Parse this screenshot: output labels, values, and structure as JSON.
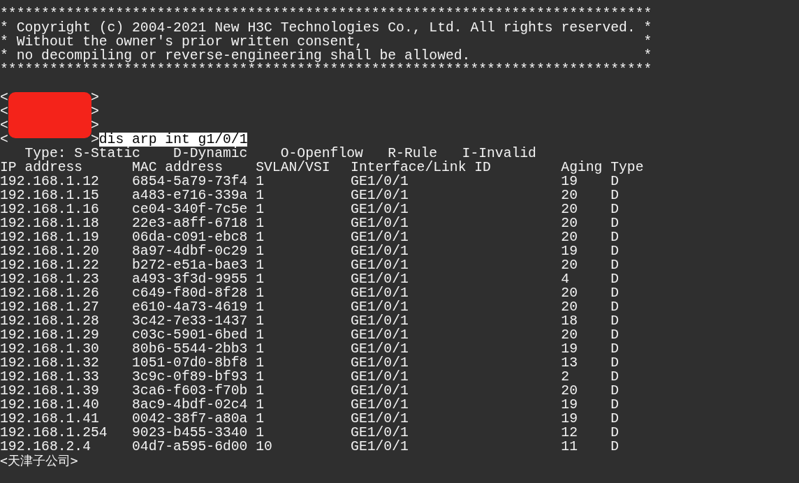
{
  "terminal": {
    "banner": [
      {
        "kind": "rule",
        "text": "*******************************************************************************"
      },
      {
        "kind": "line",
        "text": "* Copyright (c) 2004-2021 New H3C Technologies Co., Ltd. All rights reserved.",
        "end": "*"
      },
      {
        "kind": "line",
        "text": "* Without the owner's prior written consent,",
        "end": "*"
      },
      {
        "kind": "line",
        "text": "* no decompiling or reverse-engineering shall be allowed.",
        "end": "*"
      },
      {
        "kind": "rule",
        "text": "*******************************************************************************"
      }
    ],
    "prompts_redacted": true,
    "prompts": [
      {
        "open": "<",
        "close": ">"
      },
      {
        "open": "<",
        "close": ">"
      },
      {
        "open": "<",
        "close": ">"
      },
      {
        "open": "<",
        "close": ">",
        "command": "dis arp int g1/0/1",
        "selected": true
      }
    ],
    "legend": "   Type: S-Static    D-Dynamic    O-Openflow   R-Rule   I-Invalid",
    "table": {
      "columns": [
        "IP address",
        "MAC address",
        "SVLAN/VSI",
        "Interface/Link ID",
        "Aging",
        "Type"
      ],
      "rows": [
        [
          "192.168.1.12",
          "6854-5a79-73f4",
          "1",
          "GE1/0/1",
          "19",
          "D"
        ],
        [
          "192.168.1.15",
          "a483-e716-339a",
          "1",
          "GE1/0/1",
          "20",
          "D"
        ],
        [
          "192.168.1.16",
          "ce04-340f-7c5e",
          "1",
          "GE1/0/1",
          "20",
          "D"
        ],
        [
          "192.168.1.18",
          "22e3-a8ff-6718",
          "1",
          "GE1/0/1",
          "20",
          "D"
        ],
        [
          "192.168.1.19",
          "06da-c091-ebc8",
          "1",
          "GE1/0/1",
          "20",
          "D"
        ],
        [
          "192.168.1.20",
          "8a97-4dbf-0c29",
          "1",
          "GE1/0/1",
          "19",
          "D"
        ],
        [
          "192.168.1.22",
          "b272-e51a-bae3",
          "1",
          "GE1/0/1",
          "20",
          "D"
        ],
        [
          "192.168.1.23",
          "a493-3f3d-9955",
          "1",
          "GE1/0/1",
          "4",
          "D"
        ],
        [
          "192.168.1.26",
          "c649-f80d-8f28",
          "1",
          "GE1/0/1",
          "20",
          "D"
        ],
        [
          "192.168.1.27",
          "e610-4a73-4619",
          "1",
          "GE1/0/1",
          "20",
          "D"
        ],
        [
          "192.168.1.28",
          "3c42-7e33-1437",
          "1",
          "GE1/0/1",
          "18",
          "D"
        ],
        [
          "192.168.1.29",
          "c03c-5901-6bed",
          "1",
          "GE1/0/1",
          "20",
          "D"
        ],
        [
          "192.168.1.30",
          "80b6-5544-2bb3",
          "1",
          "GE1/0/1",
          "19",
          "D"
        ],
        [
          "192.168.1.32",
          "1051-07d0-8bf8",
          "1",
          "GE1/0/1",
          "13",
          "D"
        ],
        [
          "192.168.1.33",
          "3c9c-0f89-bf93",
          "1",
          "GE1/0/1",
          "2",
          "D"
        ],
        [
          "192.168.1.39",
          "3ca6-f603-f70b",
          "1",
          "GE1/0/1",
          "20",
          "D"
        ],
        [
          "192.168.1.40",
          "8ac9-4bdf-02c4",
          "1",
          "GE1/0/1",
          "19",
          "D"
        ],
        [
          "192.168.1.41",
          "0042-38f7-a80a",
          "1",
          "GE1/0/1",
          "19",
          "D"
        ],
        [
          "192.168.1.254",
          "9023-b455-3340",
          "1",
          "GE1/0/1",
          "12",
          "D"
        ],
        [
          "192.168.2.4",
          "04d7-a595-6d00",
          "10",
          "GE1/0/1",
          "11",
          "D"
        ]
      ]
    },
    "final_prompt": "<天津子公司>"
  }
}
